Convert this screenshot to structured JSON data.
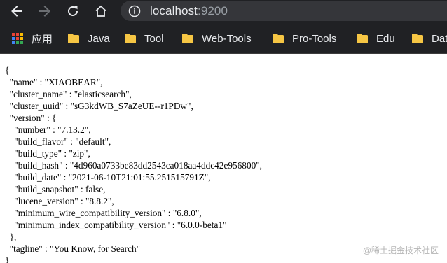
{
  "browser": {
    "url_host": "localhost",
    "url_port": ":9200"
  },
  "bookmarks": [
    {
      "label": "应用",
      "icon": "apps-grid-icon"
    },
    {
      "label": "Java",
      "icon": "folder-icon"
    },
    {
      "label": "Tool",
      "icon": "folder-icon"
    },
    {
      "label": "Web-Tools",
      "icon": "folder-icon"
    },
    {
      "label": "Pro-Tools",
      "icon": "folder-icon"
    },
    {
      "label": "Edu",
      "icon": "folder-icon"
    },
    {
      "label": "Dat",
      "icon": "folder-icon"
    }
  ],
  "json_lines": [
    "{",
    "  \"name\" : \"XIAOBEAR\",",
    "  \"cluster_name\" : \"elasticsearch\",",
    "  \"cluster_uuid\" : \"sG3kdWB_S7aZeUE--r1PDw\",",
    "  \"version\" : {",
    "    \"number\" : \"7.13.2\",",
    "    \"build_flavor\" : \"default\",",
    "    \"build_type\" : \"zip\",",
    "    \"build_hash\" : \"4d960a0733be83dd2543ca018aa4ddc42e956800\",",
    "    \"build_date\" : \"2021-06-10T21:01:55.251515791Z\",",
    "    \"build_snapshot\" : false,",
    "    \"lucene_version\" : \"8.8.2\",",
    "    \"minimum_wire_compatibility_version\" : \"6.8.0\",",
    "    \"minimum_index_compatibility_version\" : \"6.0.0-beta1\"",
    "  },",
    "  \"tagline\" : \"You Know, for Search\"",
    "}"
  ],
  "watermark": "@稀土掘金技术社区",
  "colors": {
    "toolbar_bg": "#202124",
    "omnibox_bg": "#35363a",
    "folder": "#f6c644"
  }
}
